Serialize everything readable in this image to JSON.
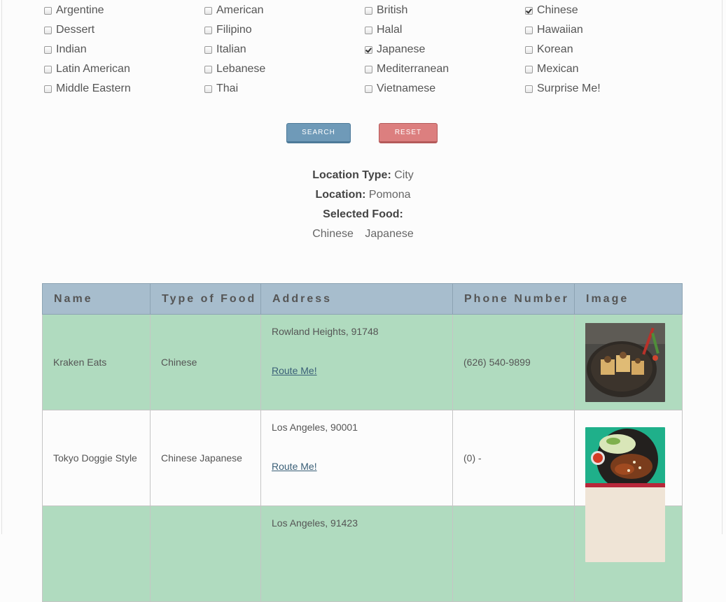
{
  "filters": [
    {
      "label": "Argentine",
      "checked": false
    },
    {
      "label": "American",
      "checked": false
    },
    {
      "label": "British",
      "checked": false
    },
    {
      "label": "Chinese",
      "checked": true
    },
    {
      "label": "Dessert",
      "checked": false
    },
    {
      "label": "Filipino",
      "checked": false
    },
    {
      "label": "Halal",
      "checked": false
    },
    {
      "label": "Hawaiian",
      "checked": false
    },
    {
      "label": "Indian",
      "checked": false
    },
    {
      "label": "Italian",
      "checked": false
    },
    {
      "label": "Japanese",
      "checked": true
    },
    {
      "label": "Korean",
      "checked": false
    },
    {
      "label": "Latin American",
      "checked": false
    },
    {
      "label": "Lebanese",
      "checked": false
    },
    {
      "label": "Mediterranean",
      "checked": false
    },
    {
      "label": "Mexican",
      "checked": false
    },
    {
      "label": "Middle Eastern",
      "checked": false
    },
    {
      "label": "Thai",
      "checked": false
    },
    {
      "label": "Vietnamese",
      "checked": false
    },
    {
      "label": "Surprise Me!",
      "checked": false
    }
  ],
  "buttons": {
    "search": "SEARCH",
    "reset": "RESET"
  },
  "summary": {
    "location_type_label": "Location Type:",
    "location_type": "City",
    "location_label": "Location:",
    "location": "Pomona",
    "selected_food_label": "Selected Food:",
    "selected_foods": [
      "Chinese",
      "Japanese"
    ]
  },
  "table": {
    "headers": [
      "Name",
      "Type of Food",
      "Address",
      "Phone Number",
      "Image"
    ],
    "rows": [
      {
        "name": "Kraken Eats",
        "type": "Chinese",
        "address": "Rowland Heights, 91748",
        "route": "Route Me!",
        "phone": "(626) 540-9899",
        "image": "fried-tofu-dish-photo"
      },
      {
        "name": "Tokyo Doggie Style",
        "type": "Chinese Japanese",
        "address": "Los Angeles, 90001",
        "route": "Route Me!",
        "phone": "(0) -",
        "image": "grilled-chicken-plate-photo"
      },
      {
        "name": "",
        "type": "",
        "address": "Los Angeles, 91423",
        "route": "",
        "phone": "",
        "image": "food-photo"
      }
    ]
  },
  "colors": {
    "search_button": "#6f9ab8",
    "reset_button": "#dc7f7f",
    "header": "#a7bdcd",
    "row_green": "#b0dbbf"
  }
}
